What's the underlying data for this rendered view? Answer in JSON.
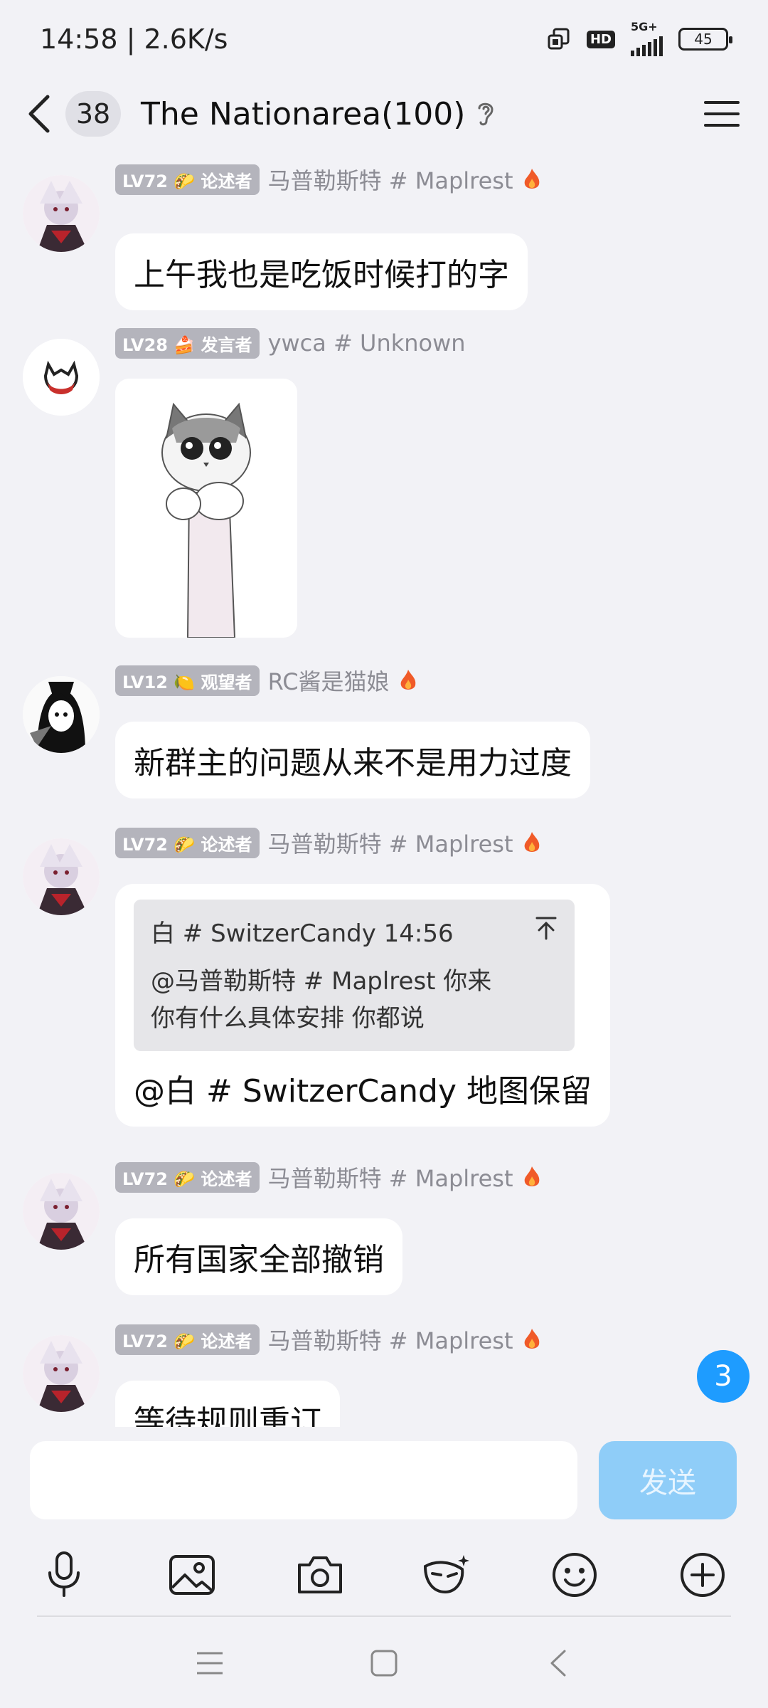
{
  "status_bar": {
    "time_speed": "14:58 | 2.6K/s",
    "hd": "HD",
    "network": "5G+",
    "battery": "45"
  },
  "header": {
    "unread_count": "38",
    "title": "The Nationarea(100)"
  },
  "messages": [
    {
      "level": "LV72 🌮 论述者",
      "sender": "马普勒斯特 # Maplrest",
      "text": "上午我也是吃饭时候打的字"
    },
    {
      "level": "LV28 🍰 发言者",
      "sender": "ywca # Unknown",
      "text": ""
    },
    {
      "level": "LV12 🍋 观望者",
      "sender": "RC酱是猫娘",
      "text": "新群主的问题从来不是用力过度"
    },
    {
      "level": "LV72 🌮 论述者",
      "sender": "马普勒斯特 # Maplrest",
      "quote_header": "白 # SwitzerCandy 14:56",
      "quote_line1": "@马普勒斯特 # Maplrest 你来",
      "quote_line2": "你有什么具体安排 你都说",
      "text": "@白 # SwitzerCandy 地图保留"
    },
    {
      "level": "LV72 🌮 论述者",
      "sender": "马普勒斯特 # Maplrest",
      "text": "所有国家全部撤销"
    },
    {
      "level": "LV72 🌮 论述者",
      "sender": "马普勒斯特 # Maplrest",
      "text": "等待规则重订"
    }
  ],
  "new_message_count": "3",
  "input": {
    "placeholder": "",
    "send_label": "发送"
  },
  "colors": {
    "accent": "#1e9cff",
    "send_disabled": "#8fcdf8",
    "background": "#f2f2f6",
    "level_badge": "#b4b4bc"
  }
}
